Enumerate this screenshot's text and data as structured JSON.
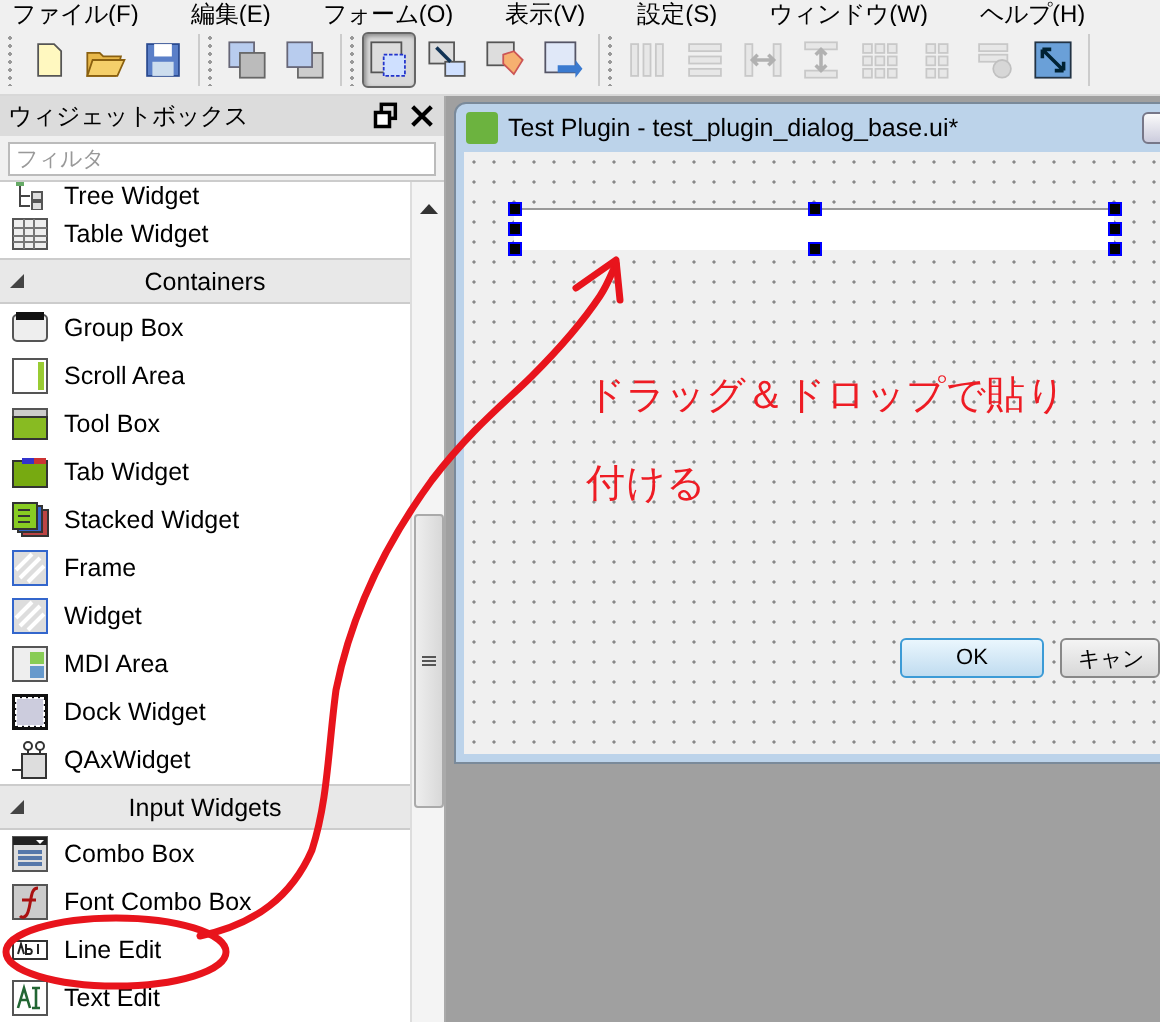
{
  "menu": [
    "ファイル(F)",
    "編集(E)",
    "フォーム(O)",
    "表示(V)",
    "設定(S)",
    "ウィンドウ(W)",
    "ヘルプ(H)"
  ],
  "toolbar": [
    [
      {
        "selected": false,
        "disabled": false
      },
      {
        "selected": false,
        "disabled": false
      },
      {
        "selected": false,
        "disabled": false
      }
    ],
    [
      {
        "selected": false,
        "disabled": false
      },
      {
        "selected": false,
        "disabled": false
      }
    ],
    [
      {
        "selected": true,
        "disabled": false
      },
      {
        "selected": false,
        "disabled": false
      },
      {
        "selected": false,
        "disabled": false
      },
      {
        "selected": false,
        "disabled": false
      }
    ],
    [
      {
        "selected": false,
        "disabled": true
      },
      {
        "selected": false,
        "disabled": true
      },
      {
        "selected": false,
        "disabled": true
      },
      {
        "selected": false,
        "disabled": true
      },
      {
        "selected": false,
        "disabled": true
      },
      {
        "selected": false,
        "disabled": true
      },
      {
        "selected": false,
        "disabled": true
      },
      {
        "selected": false,
        "disabled": false
      }
    ]
  ],
  "widget_box": {
    "title": "ウィジェットボックス",
    "filter": {
      "placeholder": "フィルタ"
    },
    "items": [
      {
        "kind": "item",
        "label": "Tree Widget"
      },
      {
        "kind": "item",
        "label": "Table Widget"
      },
      {
        "kind": "category",
        "label": "Containers",
        "expanded": true
      },
      {
        "kind": "item",
        "label": "Group Box"
      },
      {
        "kind": "item",
        "label": "Scroll Area"
      },
      {
        "kind": "item",
        "label": "Tool Box"
      },
      {
        "kind": "item",
        "label": "Tab Widget"
      },
      {
        "kind": "item",
        "label": "Stacked Widget"
      },
      {
        "kind": "item",
        "label": "Frame"
      },
      {
        "kind": "item",
        "label": "Widget"
      },
      {
        "kind": "item",
        "label": "MDI Area"
      },
      {
        "kind": "item",
        "label": "Dock Widget"
      },
      {
        "kind": "item",
        "label": "QAxWidget"
      },
      {
        "kind": "category",
        "label": "Input Widgets",
        "expanded": true
      },
      {
        "kind": "item",
        "label": "Combo Box"
      },
      {
        "kind": "item",
        "label": "Font Combo Box"
      },
      {
        "kind": "item",
        "label": "Line Edit"
      },
      {
        "kind": "item",
        "label": "Text Edit"
      }
    ]
  },
  "form": {
    "title": "Test Plugin - test_plugin_dialog_base.ui*",
    "annotation": "ドラッグ＆ドロップで貼り付ける",
    "buttons": [
      "OK",
      "キャン"
    ]
  }
}
